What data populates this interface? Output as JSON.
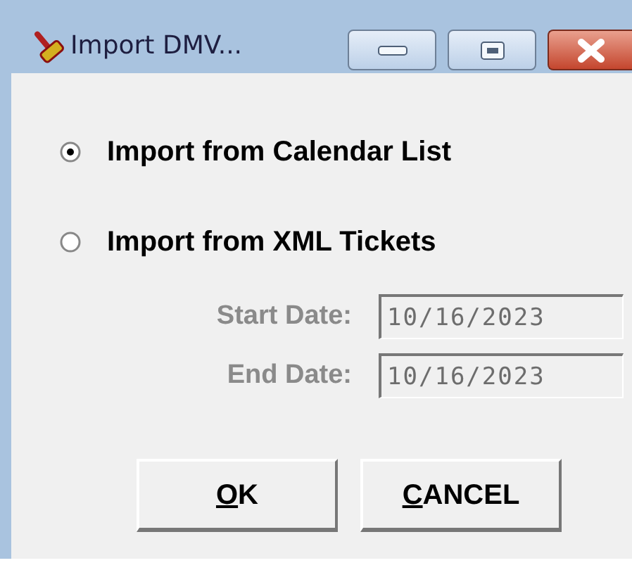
{
  "window": {
    "title": "Import DMV..."
  },
  "options": [
    {
      "label": "Import from Calendar List",
      "selected": true
    },
    {
      "label": "Import from XML Tickets",
      "selected": false
    }
  ],
  "fields": [
    {
      "label": "Start Date:",
      "value": "10/16/2023",
      "disabled": true
    },
    {
      "label": "End Date:",
      "value": "10/16/2023",
      "disabled": true
    }
  ],
  "buttons": [
    {
      "label": "OK",
      "underline_first": true
    },
    {
      "label": "CANCEL",
      "underline_first": true
    }
  ]
}
